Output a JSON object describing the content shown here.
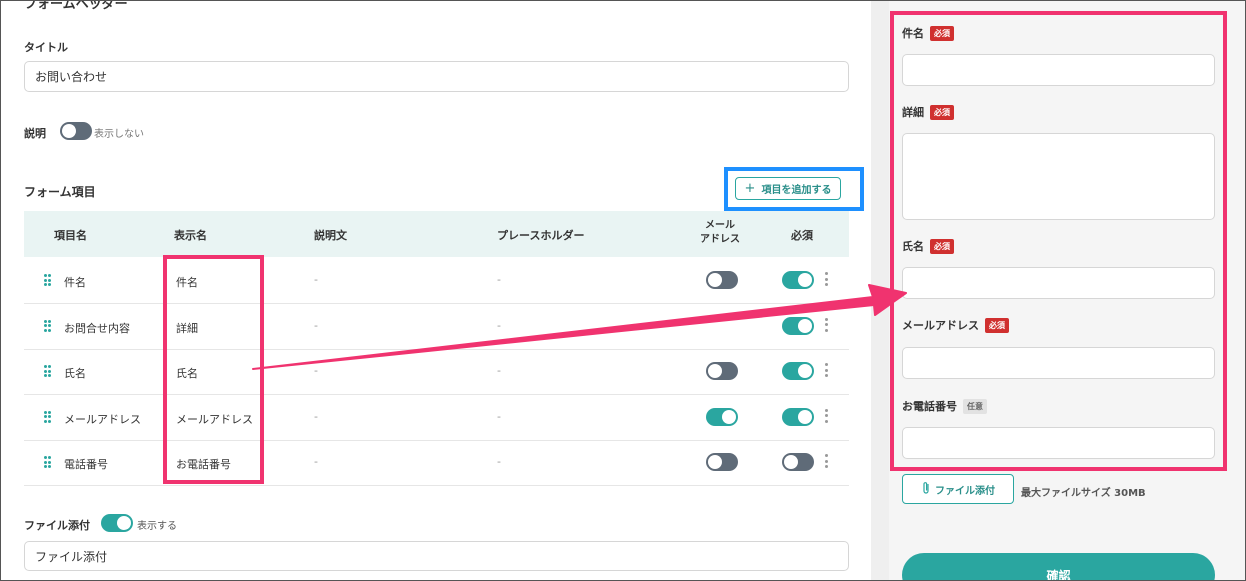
{
  "form_header": {
    "section_title": "フォームヘッダー",
    "title_label": "タイトル",
    "title_value": "お問い合わせ",
    "description_label": "説明",
    "description_toggle_text": "表示しない"
  },
  "form_items": {
    "section_title": "フォーム項目",
    "add_button_label": "項目を追加する",
    "columns": [
      "項目名",
      "表示名",
      "説明文",
      "プレースホルダー",
      "メール\nアドレス",
      "必須"
    ],
    "rows": [
      {
        "name": "件名",
        "display": "件名",
        "desc": "-",
        "placeholder": "-",
        "mail": false,
        "required": true
      },
      {
        "name": "お問合せ内容",
        "display": "詳細",
        "desc": "-",
        "placeholder": "-",
        "mail": null,
        "required": true
      },
      {
        "name": "氏名",
        "display": "氏名",
        "desc": "-",
        "placeholder": "-",
        "mail": false,
        "required": true
      },
      {
        "name": "メールアドレス",
        "display": "メールアドレス",
        "desc": "-",
        "placeholder": "-",
        "mail": true,
        "required": true
      },
      {
        "name": "電話番号",
        "display": "お電話番号",
        "desc": "-",
        "placeholder": "-",
        "mail": false,
        "required": false
      }
    ]
  },
  "file_attach": {
    "label": "ファイル添付",
    "toggle_text": "表示する",
    "field_value": "ファイル添付"
  },
  "preview": {
    "required_badge": "必須",
    "optional_badge": "任意",
    "fields": [
      {
        "label": "件名",
        "badge": "required"
      },
      {
        "label": "詳細",
        "badge": "required"
      },
      {
        "label": "氏名",
        "badge": "required"
      },
      {
        "label": "メールアドレス",
        "badge": "required"
      },
      {
        "label": "お電話番号",
        "badge": "optional"
      }
    ],
    "file_button_label": "ファイル添付",
    "file_note": "最大ファイルサイズ 30MB",
    "confirm_label": "確認"
  },
  "colors": {
    "accent": "#2aa6a0",
    "highlight_pink": "#f0336f",
    "highlight_blue": "#1e90ff",
    "required_red": "#d0302f"
  }
}
